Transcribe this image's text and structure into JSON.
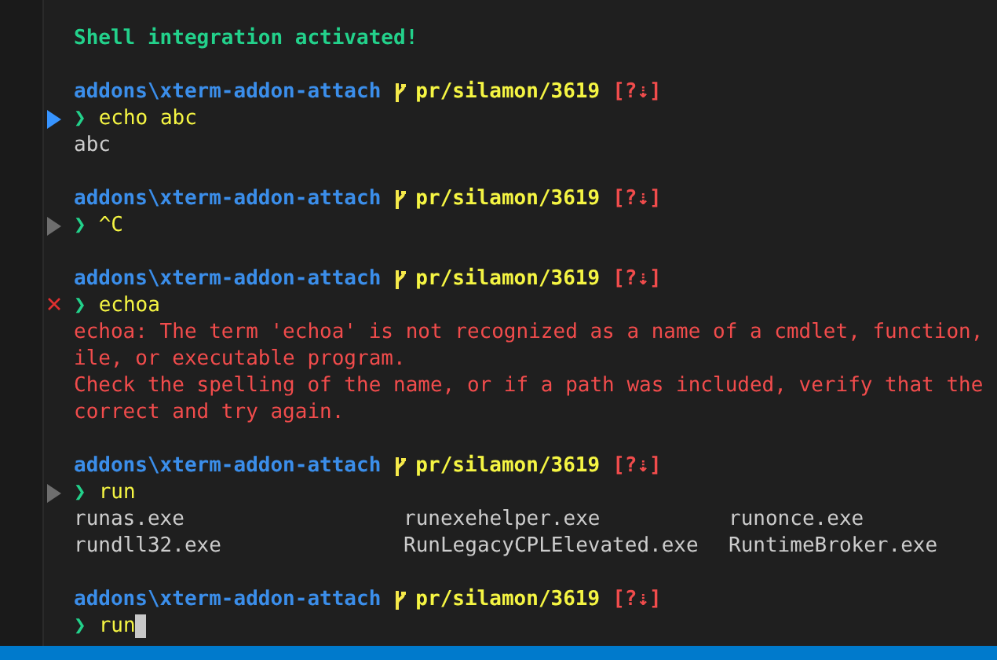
{
  "terminal": {
    "lines": [
      {
        "kind": "banner",
        "text": "Shell integration activated!"
      },
      {
        "kind": "blank"
      },
      {
        "kind": "prompt",
        "path": "addons\\xterm-addon-attach",
        "branch": "pr/silamon/3619",
        "status": "[?⇣]"
      },
      {
        "kind": "command",
        "marked": true,
        "succeeded": true,
        "failed": false,
        "symbol": "❯",
        "text": "echo abc",
        "cursor": false
      },
      {
        "kind": "output",
        "text": "abc"
      },
      {
        "kind": "blank"
      },
      {
        "kind": "prompt",
        "path": "addons\\xterm-addon-attach",
        "branch": "pr/silamon/3619",
        "status": "[?⇣]"
      },
      {
        "kind": "command",
        "marked": true,
        "succeeded": false,
        "failed": false,
        "symbol": "❯",
        "text": "^C",
        "cursor": false
      },
      {
        "kind": "blank"
      },
      {
        "kind": "prompt",
        "path": "addons\\xterm-addon-attach",
        "branch": "pr/silamon/3619",
        "status": "[?⇣]"
      },
      {
        "kind": "command",
        "marked": true,
        "failed": true,
        "symbol": "❯",
        "text": "echoa",
        "cursor": false
      },
      {
        "kind": "error",
        "text": "echoa: The term 'echoa' is not recognized as a name of a cmdlet, function,"
      },
      {
        "kind": "error",
        "text": "ile, or executable program."
      },
      {
        "kind": "error",
        "text": "Check the spelling of the name, or if a path was included, verify that the"
      },
      {
        "kind": "error",
        "text": "correct and try again."
      },
      {
        "kind": "blank"
      },
      {
        "kind": "prompt",
        "path": "addons\\xterm-addon-attach",
        "branch": "pr/silamon/3619",
        "status": "[?⇣]"
      },
      {
        "kind": "command",
        "marked": true,
        "succeeded": false,
        "failed": false,
        "symbol": "❯",
        "text": "run",
        "cursor": false
      },
      {
        "kind": "completions",
        "items": [
          "runas.exe",
          "runexehelper.exe",
          "runonce.exe",
          "rundll32.exe",
          "RunLegacyCPLElevated.exe",
          "RuntimeBroker.exe"
        ]
      },
      {
        "kind": "blank"
      },
      {
        "kind": "prompt",
        "path": "addons\\xterm-addon-attach",
        "branch": "pr/silamon/3619",
        "status": "[?⇣]"
      },
      {
        "kind": "command",
        "marked": false,
        "symbol": "❯",
        "text": "run",
        "cursor": true
      }
    ]
  }
}
